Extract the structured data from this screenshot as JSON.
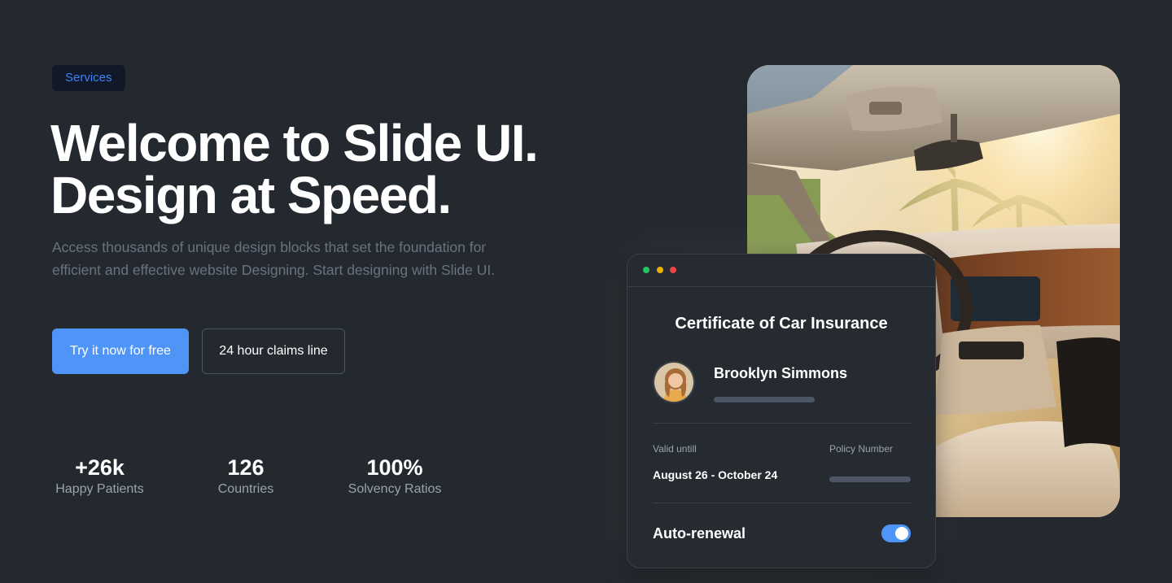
{
  "hero": {
    "badge": "Services",
    "headline_line1": "Welcome to Slide UI.",
    "headline_line2": "Design at Speed.",
    "description": "Access thousands of unique design blocks that set the foundation for efficient and effective website Designing. Start designing with Slide UI.",
    "primary_button": "Try it now for free",
    "secondary_button": "24 hour claims line"
  },
  "stats": [
    {
      "value": "+26k",
      "label": "Happy Patients"
    },
    {
      "value": "126",
      "label": "Countries"
    },
    {
      "value": "100%",
      "label": "Solvency Ratios"
    }
  ],
  "card": {
    "title": "Certificate of Car Insurance",
    "person_name": "Brooklyn Simmons",
    "valid_label": "Valid untill",
    "valid_value": "August 26 - October 24",
    "policy_label": "Policy Number",
    "renewal_label": "Auto-renewal",
    "renewal_on": true,
    "window_dots": [
      "#22c55e",
      "#eab308",
      "#ef4444"
    ]
  },
  "colors": {
    "background": "#24292f",
    "accent": "#4f95f8",
    "badge_text": "#3b82f6",
    "card": "#262b31"
  },
  "images": {
    "hero_photo": "car-interior-photo",
    "avatar": "woman-portrait-photo"
  }
}
